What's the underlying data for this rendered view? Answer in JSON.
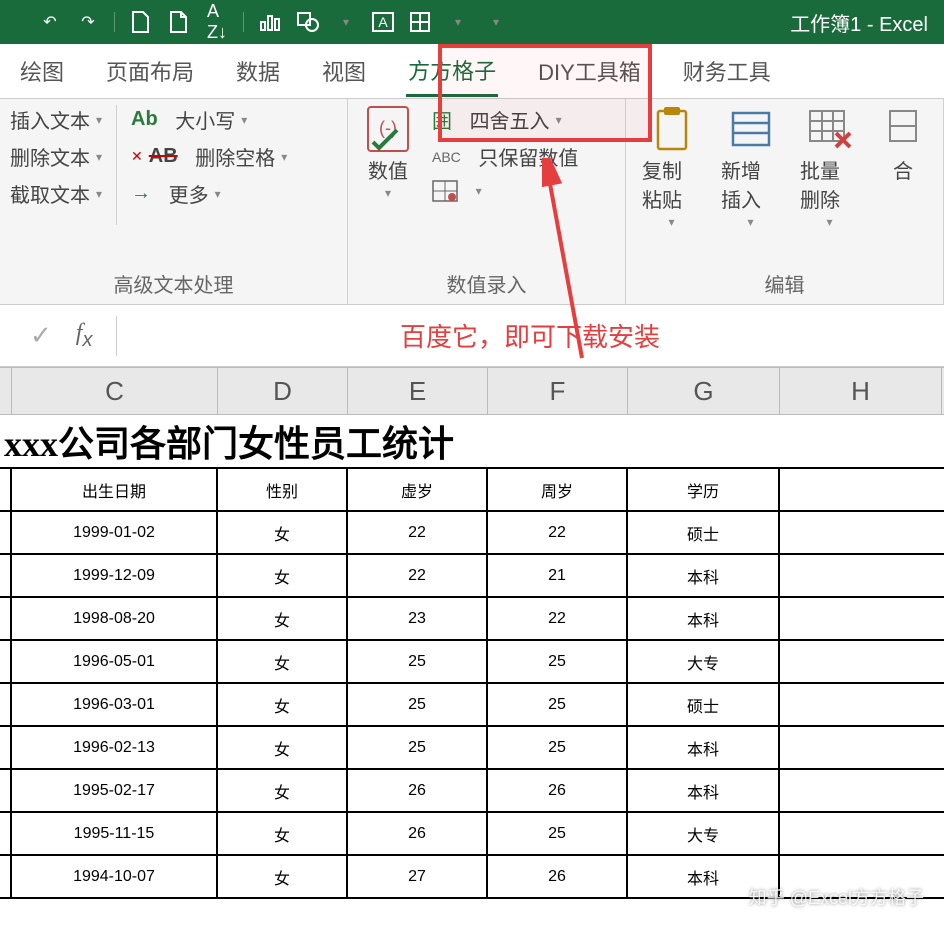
{
  "title": "工作簿1 - Excel",
  "tabs": [
    "绘图",
    "页面布局",
    "数据",
    "视图",
    "方方格子",
    "DIY工具箱",
    "财务工具"
  ],
  "active_tab": 4,
  "ribbon": {
    "text_group": {
      "label": "高级文本处理",
      "col1": [
        "插入文本",
        "删除文本",
        "截取文本"
      ],
      "col2_case_prefix": "Ab",
      "col2_case": "大小写",
      "col2_del_prefix": "AB",
      "col2_del": "删除空格",
      "col2_more": "更多"
    },
    "num_group": {
      "label": "数值录入",
      "big": "数值",
      "r1_prefix": "囲",
      "r1": "四舍五入",
      "r2_prefix": "ABC",
      "r2": "只保留数值"
    },
    "edit_group": {
      "label": "编辑",
      "b1": "复制粘贴",
      "b2": "新增插入",
      "b3": "批量删除",
      "b4": "合"
    }
  },
  "annotation": "百度它，即可下载安装",
  "columns": [
    "C",
    "D",
    "E",
    "F",
    "G",
    "H"
  ],
  "sheet_title": "xxx公司各部门女性员工统计",
  "headers": [
    "出生日期",
    "性别",
    "虚岁",
    "周岁",
    "学历"
  ],
  "rows": [
    [
      "1999-01-02",
      "女",
      "22",
      "22",
      "硕士"
    ],
    [
      "1999-12-09",
      "女",
      "22",
      "21",
      "本科"
    ],
    [
      "1998-08-20",
      "女",
      "23",
      "22",
      "本科"
    ],
    [
      "1996-05-01",
      "女",
      "25",
      "25",
      "大专"
    ],
    [
      "1996-03-01",
      "女",
      "25",
      "25",
      "硕士"
    ],
    [
      "1996-02-13",
      "女",
      "25",
      "25",
      "本科"
    ],
    [
      "1995-02-17",
      "女",
      "26",
      "26",
      "本科"
    ],
    [
      "1995-11-15",
      "女",
      "26",
      "25",
      "大专"
    ],
    [
      "1994-10-07",
      "女",
      "27",
      "26",
      "本科"
    ]
  ],
  "watermark": "知乎 @Excel方方格子"
}
